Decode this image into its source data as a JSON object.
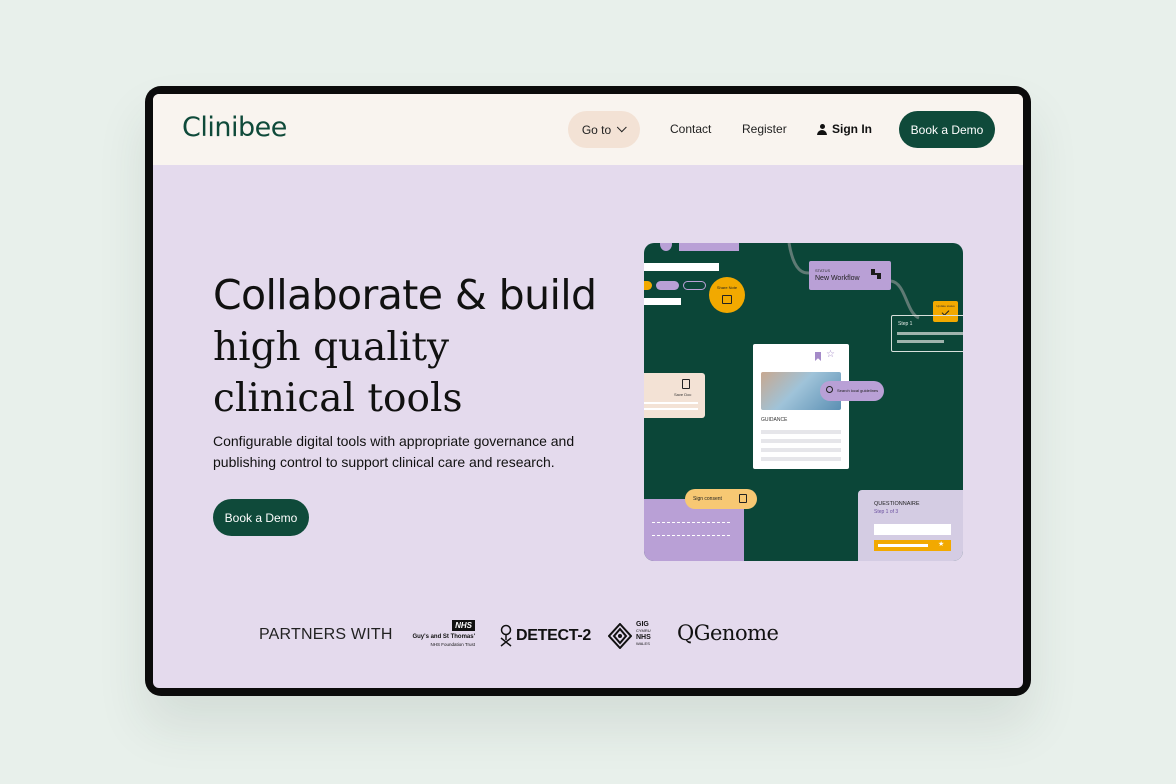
{
  "nav": {
    "logo": "Clinibee",
    "goto_label": "Go to",
    "contact_label": "Contact",
    "register_label": "Register",
    "signin_label": "Sign In",
    "book_demo_label": "Book a Demo"
  },
  "hero": {
    "headline": "Collaborate & build",
    "serif_line1": "high quality",
    "serif_line2": "clinical tools",
    "description": "Configurable digital tools with appropriate governance and publishing control to support clinical care and research.",
    "cta_label": "Book a Demo"
  },
  "illustration": {
    "new_workflow_small": "STATUS",
    "new_workflow": "New Workflow",
    "share_note": "Share Note",
    "update_note": "Update status",
    "step1": "Step 1",
    "search_guidelines": "Search local guidelines",
    "guidance": "GUIDANCE",
    "file_label": "Save Doc",
    "sign_consent": "Sign consent",
    "questionnaire": "QUESTIONNAIRE",
    "questionnaire_step": "Step 1 of 3"
  },
  "partners": {
    "label": "PARTNERS WITH",
    "nhs_badge": "NHS",
    "guys_name": "Guy's and St Thomas'",
    "guys_sub": "NHS Foundation Trust",
    "detect": "DETECT-2",
    "gig_line1": "GIG",
    "gig_line2": "CYMRU",
    "gig_line3": "NHS",
    "gig_line4": "WALES",
    "qgenome": "QGenome"
  },
  "colors": {
    "brand_green": "#0f4a3a",
    "hero_bg": "#e4daed",
    "nav_bg": "#f9f4ef",
    "accent_purple": "#b9a0d6",
    "accent_amber": "#f2a900"
  }
}
